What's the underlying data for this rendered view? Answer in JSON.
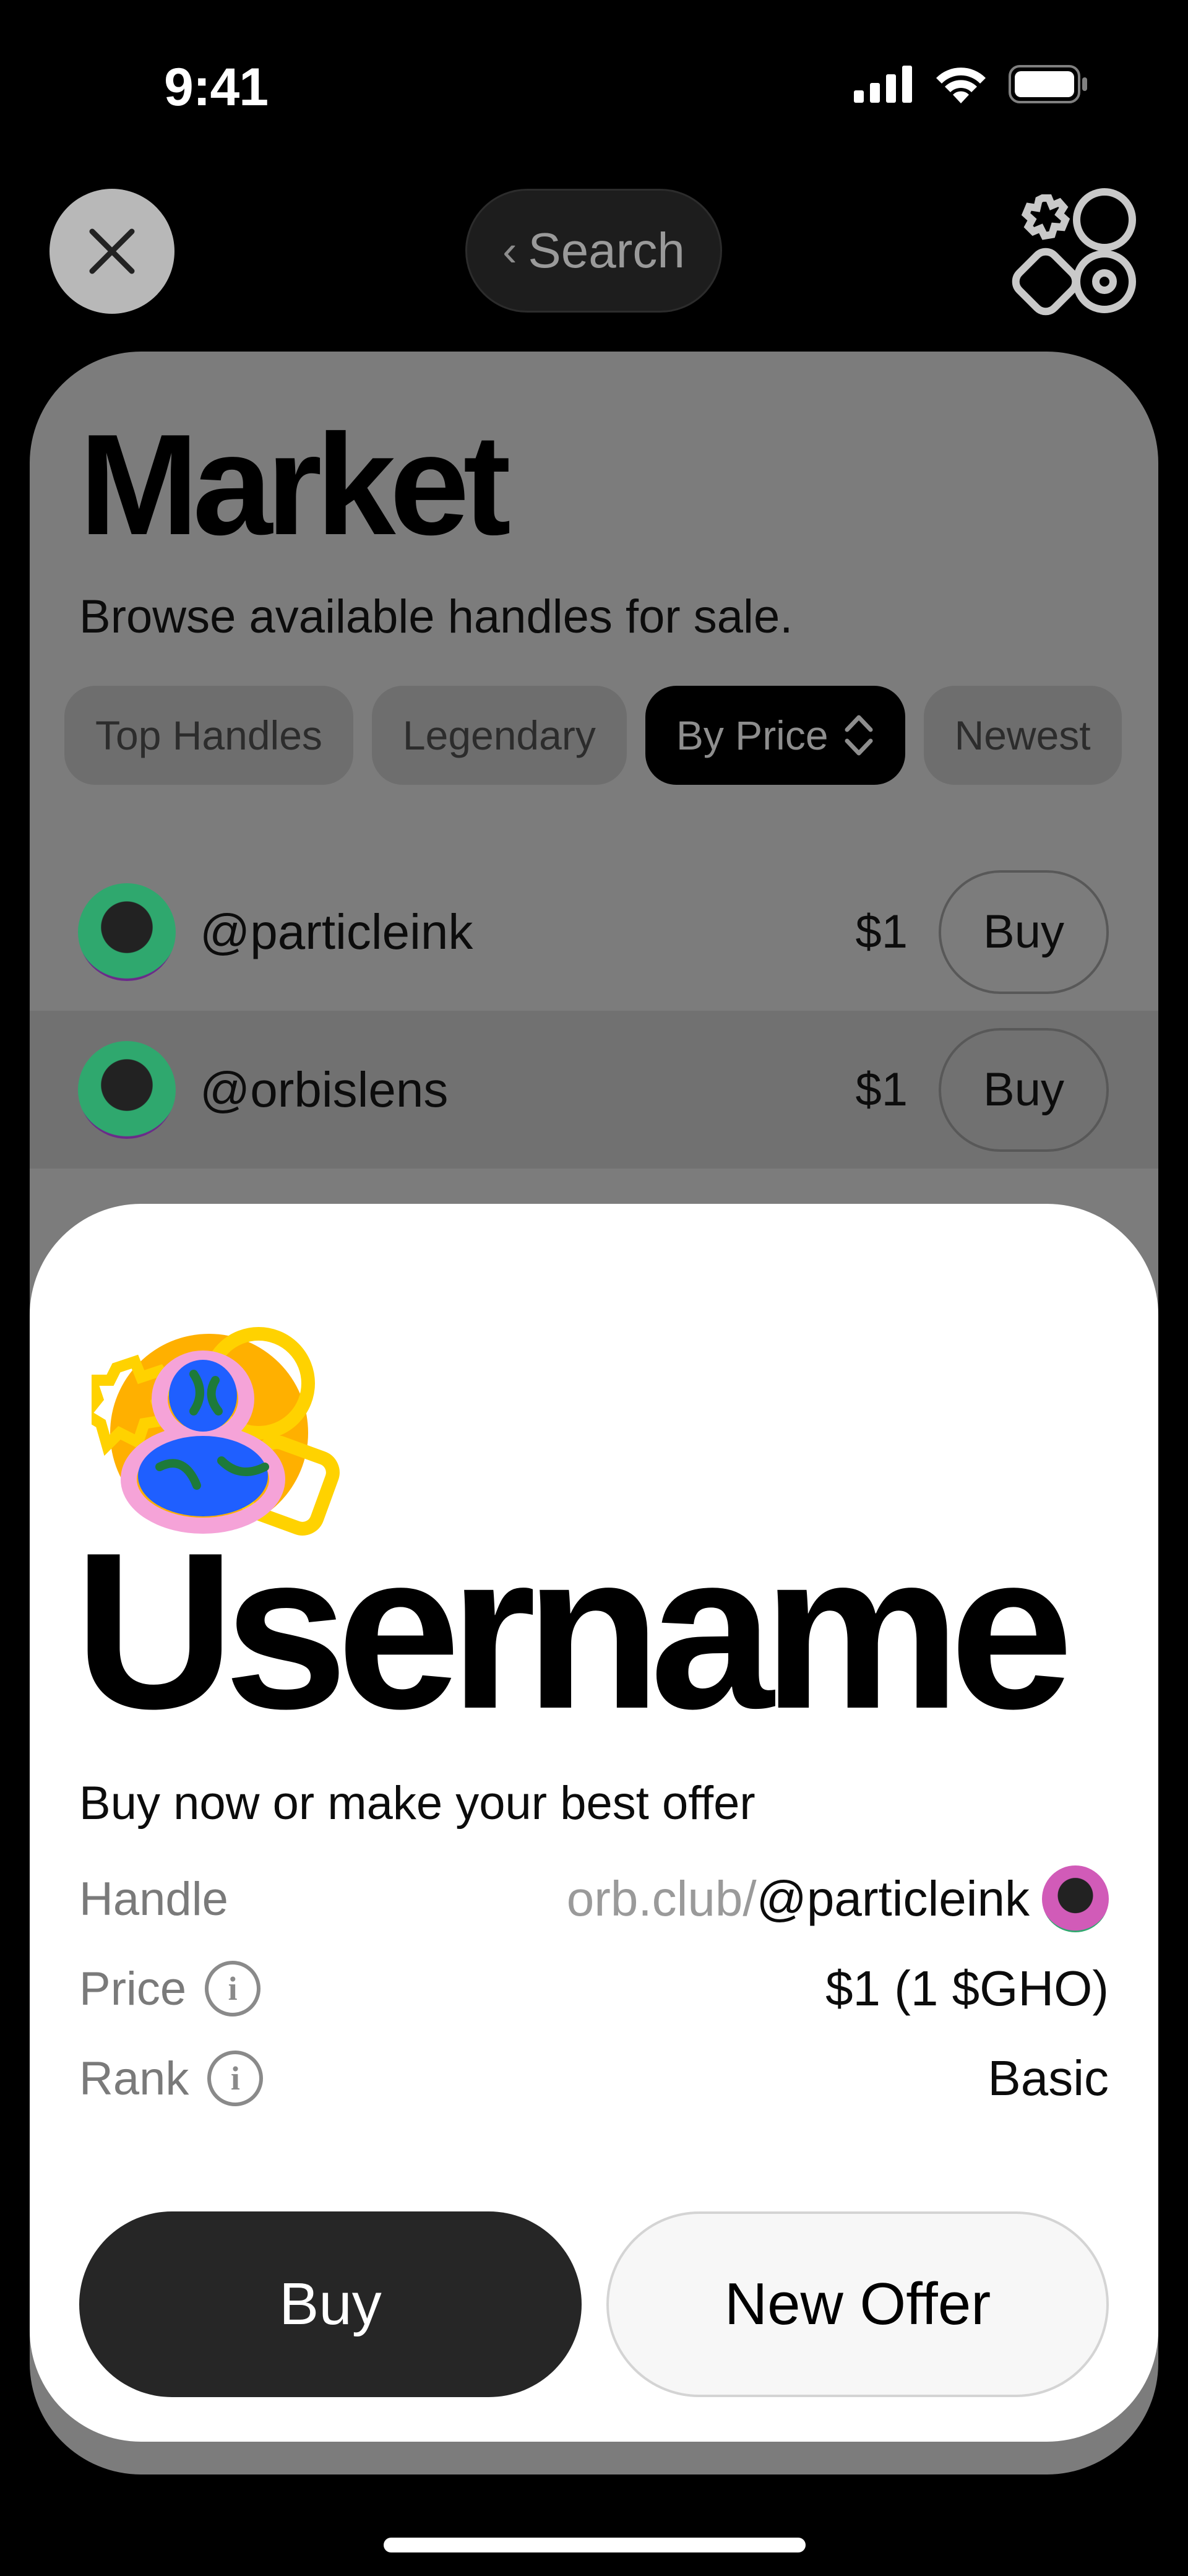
{
  "status_bar": {
    "time": "9:41",
    "icons": [
      "cellular-signal-icon",
      "wifi-icon",
      "battery-icon"
    ]
  },
  "nav": {
    "close_icon": "close-icon",
    "search_label": "Search",
    "back_glyph": "‹",
    "app_logo": "orb-logo-icon"
  },
  "market": {
    "title": "Market",
    "subtitle": "Browse available handles for sale.",
    "filters": [
      {
        "label": "Top Handles",
        "active": false
      },
      {
        "label": "Legendary",
        "active": false
      },
      {
        "label": "By Price",
        "active": true
      },
      {
        "label": "Newest",
        "active": false
      }
    ],
    "rows": [
      {
        "handle": "@particleink",
        "price": "$1",
        "action": "Buy"
      },
      {
        "handle": "@orbislens",
        "price": "$1",
        "action": "Buy"
      }
    ]
  },
  "sheet": {
    "title": "Username",
    "subtitle": "Buy now or make your best offer",
    "details": {
      "handle_label": "Handle",
      "handle_prefix": "orb.club/",
      "handle_value": "@particleink",
      "price_label": "Price",
      "price_value": "$1 (1 $GHO)",
      "rank_label": "Rank",
      "rank_value": "Basic"
    },
    "buy_label": "Buy",
    "offer_label": "New Offer"
  },
  "colors": {
    "accent_dark": "#262626",
    "logo_yellow": "#ffd200",
    "logo_orange": "#ffb000",
    "logo_pink": "#f5a3d8",
    "logo_blue": "#1f5fff",
    "logo_green": "#1d7a3a"
  }
}
